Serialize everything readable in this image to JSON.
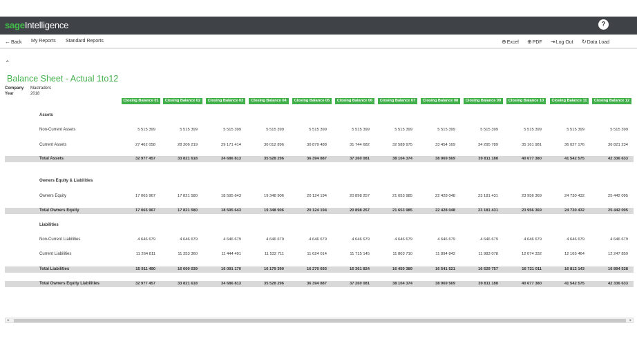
{
  "brand": {
    "prefix": "sage",
    "suffix": "Intelligence"
  },
  "help_label": "?",
  "nav": {
    "back": "Back",
    "my_reports": "My Reports",
    "standard_reports": "Standard Reports",
    "excel": "Excel",
    "pdf": "PDF",
    "logout": "Log Out",
    "data_load": "Data Load"
  },
  "report": {
    "title": "Balance Sheet - Actual 1to12",
    "company_label": "Company",
    "company_value": "Mactraders",
    "year_label": "Year",
    "year_value": "2018",
    "columns": [
      "Closing Balance 01",
      "Closing Balance 02",
      "Closing Balance 03",
      "Closing Balance 04",
      "Closing Balance 05",
      "Closing Balance 06",
      "Closing Balance 07",
      "Closing Balance 08",
      "Closing Balance 09",
      "Closing Balance 10",
      "Closing Balance 11",
      "Closing Balance 12"
    ],
    "sections": {
      "assets": "Assets",
      "equity": "Owners Equity & Liabilities",
      "liabilities": "Liabilities"
    },
    "rows": [
      {
        "label": "Non-Current Assets",
        "total": false,
        "values": [
          "5 515 399",
          "5 515 399",
          "5 515 399",
          "5 515 399",
          "5 515 399",
          "5 515 399",
          "5 515 399",
          "5 515 399",
          "5 515 399",
          "5 515 399",
          "5 515 399",
          "5 515 399"
        ]
      },
      {
        "label": "Current Assets",
        "total": false,
        "values": [
          "27 462 058",
          "28 306 219",
          "29 171 414",
          "30 012 896",
          "30 879 488",
          "31 744 682",
          "32 588 975",
          "33 454 169",
          "34 295 789",
          "35 161 981",
          "36 027 176",
          "36 821 234"
        ]
      },
      {
        "label": "Total Assets",
        "total": true,
        "values": [
          "32 977 457",
          "33 821 618",
          "34 686 813",
          "35 528 296",
          "36 394 887",
          "37 260 081",
          "38 104 374",
          "38 969 569",
          "39 811 188",
          "40 677 380",
          "41 542 575",
          "42 336 633"
        ]
      },
      {
        "label": "Owners Equity",
        "total": false,
        "values": [
          "17 065 967",
          "17 821 580",
          "18 595 643",
          "19 348 906",
          "20 124 194",
          "20 898 257",
          "21 653 985",
          "22 428 048",
          "23 181 431",
          "23 956 369",
          "24 730 432",
          "25 442 095"
        ]
      },
      {
        "label": "Total Owners Equity",
        "total": true,
        "values": [
          "17 065 967",
          "17 821 580",
          "18 595 643",
          "19 348 906",
          "20 124 194",
          "20 898 257",
          "21 653 985",
          "22 428 048",
          "23 181 431",
          "23 956 369",
          "24 730 432",
          "25 442 095"
        ]
      },
      {
        "label": "Non-Current Liabilities",
        "total": false,
        "values": [
          "4 646 679",
          "4 646 679",
          "4 646 679",
          "4 646 679",
          "4 646 679",
          "4 646 679",
          "4 646 679",
          "4 646 679",
          "4 646 679",
          "4 646 679",
          "4 646 679",
          "4 646 679"
        ]
      },
      {
        "label": "Current Liabilities",
        "total": false,
        "values": [
          "11 264 811",
          "11 353 360",
          "11 444 491",
          "11 532 711",
          "11 624 014",
          "11 715 145",
          "11 803 710",
          "11 894 842",
          "11 983 078",
          "12 074 332",
          "12 165 464",
          "12 247 859"
        ]
      },
      {
        "label": "Total Liabilities",
        "total": true,
        "values": [
          "15 911 490",
          "16 000 039",
          "16 091 170",
          "16 179 390",
          "16 270 693",
          "16 361 824",
          "16 450 389",
          "16 541 521",
          "16 629 757",
          "16 721 011",
          "16 812 143",
          "16 894 538"
        ]
      },
      {
        "label": "Total Owners Equity Liabilities",
        "total": true,
        "values": [
          "32 977 457",
          "33 821 618",
          "34 686 813",
          "35 528 296",
          "36 394 887",
          "37 260 081",
          "38 104 374",
          "38 969 569",
          "39 811 188",
          "40 677 380",
          "41 542 575",
          "42 336 633"
        ]
      }
    ]
  },
  "icons": {
    "back": "arrow-left-icon",
    "excel": "excel-icon",
    "pdf": "pdf-icon",
    "logout": "logout-icon",
    "data_load": "refresh-icon",
    "collapse": "chevron-up-icon",
    "help": "help-icon"
  },
  "colors": {
    "accent": "#41b04a",
    "header_bg": "#3f4247",
    "total_row_bg": "#d9d9d9"
  }
}
